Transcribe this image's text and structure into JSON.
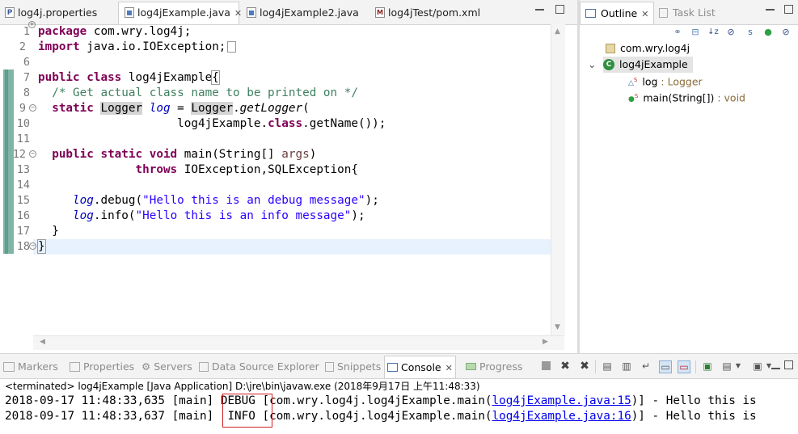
{
  "editor": {
    "tabs": [
      {
        "label": "log4j.properties",
        "icon": "properties-file-icon"
      },
      {
        "label": "log4jExample.java",
        "icon": "java-file-icon",
        "active": true
      },
      {
        "label": "log4jExample2.java",
        "icon": "java-file-icon"
      },
      {
        "label": "log4jTest/pom.xml",
        "icon": "maven-pom-icon"
      }
    ],
    "line_numbers": [
      "1",
      "2",
      "6",
      "7",
      "8",
      "9",
      "10",
      "11",
      "12",
      "13",
      "14",
      "15",
      "16",
      "17",
      "18"
    ],
    "code": {
      "l1_kw": "package",
      "l1_rest": " com.wry.log4j;",
      "l2_kw": "import",
      "l2_rest": " java.io.IOException;",
      "l7_kw": "public class",
      "l7_name": " log4jExample",
      "l7_brace": "{",
      "l8_comment": "/* Get actual class name to be printed on */",
      "l9_kw": "static",
      "l9_type": "Logger",
      "l9_field": "log",
      "l9_eq": " = ",
      "l9_type2": "Logger",
      "l9_call": ".",
      "l9_method": "getLogger",
      "l9_paren": "(",
      "l10_pre": "log4jExample.",
      "l10_kw": "class",
      "l10_post": ".getName());",
      "l12_kw": "public static void",
      "l12_rest": " main(String[] ",
      "l12_var": "args",
      "l12_end": ")",
      "l13_kw": "throws",
      "l13_rest": " IOException,SQLException{",
      "l15_field": "log",
      "l15_call": ".debug(",
      "l15_str": "\"Hello this is an debug message\"",
      "l15_end": ");",
      "l16_field": "log",
      "l16_call": ".info(",
      "l16_str": "\"Hello this is an info message\"",
      "l16_end": ");",
      "l17": "}",
      "l18": "}"
    }
  },
  "outline": {
    "tabs": [
      {
        "label": "Outline",
        "active": true
      },
      {
        "label": "Task List"
      }
    ],
    "tree": {
      "package": "com.wry.log4j",
      "class": "log4jExample",
      "members": [
        {
          "name": "log",
          "type": " : Logger"
        },
        {
          "name": "main(String[])",
          "type": " : void"
        }
      ]
    }
  },
  "bottom": {
    "tabs": [
      {
        "label": "Markers"
      },
      {
        "label": "Properties"
      },
      {
        "label": "Servers"
      },
      {
        "label": "Data Source Explorer"
      },
      {
        "label": "Snippets"
      },
      {
        "label": "Console",
        "active": true
      },
      {
        "label": "Progress"
      }
    ],
    "terminated": "<terminated> log4jExample [Java Application] D:\\jre\\bin\\javaw.exe (2018年9月17日 上午11:48:33)",
    "console_lines": [
      {
        "prefix": "2018-09-17 11:48:33,635 [main] ",
        "level": "DEBUG",
        "mid": " [com.wry.log4j.log4jExample.main(",
        "link": "log4jExample.java:15",
        "suffix": ")] - Hello this is"
      },
      {
        "prefix": "2018-09-17 11:48:33,637 [main] ",
        "level": " INFO",
        "mid": " [com.wry.log4j.log4jExample.main(",
        "link": "log4jExample.java:16",
        "suffix": ")] - Hello this is"
      }
    ]
  },
  "colors": {
    "keyword": "#7f0055",
    "comment": "#3f7f5f",
    "string": "#2a00ff",
    "field": "#0000c0",
    "highlight_box": "#d02020"
  }
}
